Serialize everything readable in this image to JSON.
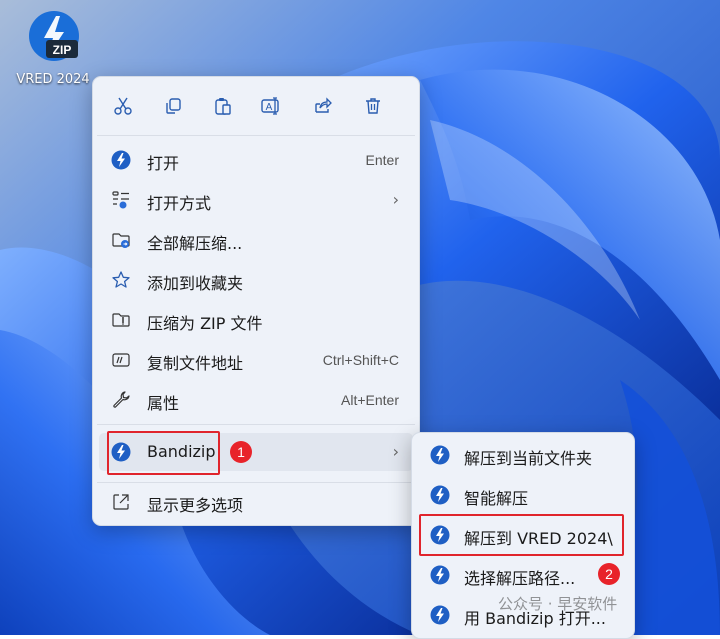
{
  "desktop": {
    "icon_label": "VRED 2024",
    "icon_badge_text": "ZIP",
    "icon_color": "#1a6ed8"
  },
  "context_menu": {
    "toolbar": [
      {
        "name": "cut-icon",
        "label": "cut"
      },
      {
        "name": "copy-icon",
        "label": "copy"
      },
      {
        "name": "paste-icon",
        "label": "paste"
      },
      {
        "name": "rename-icon",
        "label": "rename"
      },
      {
        "name": "share-icon",
        "label": "share"
      },
      {
        "name": "delete-icon",
        "label": "delete"
      }
    ],
    "items": [
      {
        "label": "打开",
        "shortcut": "Enter"
      },
      {
        "label": "打开方式",
        "shortcut": ""
      },
      {
        "label": "全部解压缩...",
        "shortcut": ""
      },
      {
        "label": "添加到收藏夹",
        "shortcut": ""
      },
      {
        "label": "压缩为 ZIP 文件",
        "shortcut": ""
      },
      {
        "label": "复制文件地址",
        "shortcut": "Ctrl+Shift+C"
      },
      {
        "label": "属性",
        "shortcut": "Alt+Enter"
      },
      {
        "label": "Bandizip",
        "shortcut": ""
      },
      {
        "label": "显示更多选项",
        "shortcut": ""
      }
    ]
  },
  "submenu": {
    "items": [
      {
        "label": "解压到当前文件夹"
      },
      {
        "label": "智能解压"
      },
      {
        "label": "解压到 VRED 2024\\"
      },
      {
        "label": "选择解压路径..."
      },
      {
        "label": "用 Bandizip 打开..."
      }
    ]
  },
  "annotations": {
    "badge1": "1",
    "badge2": "2",
    "highlight_color": "#e0242c"
  },
  "watermark": "公众号 · 早安软件"
}
